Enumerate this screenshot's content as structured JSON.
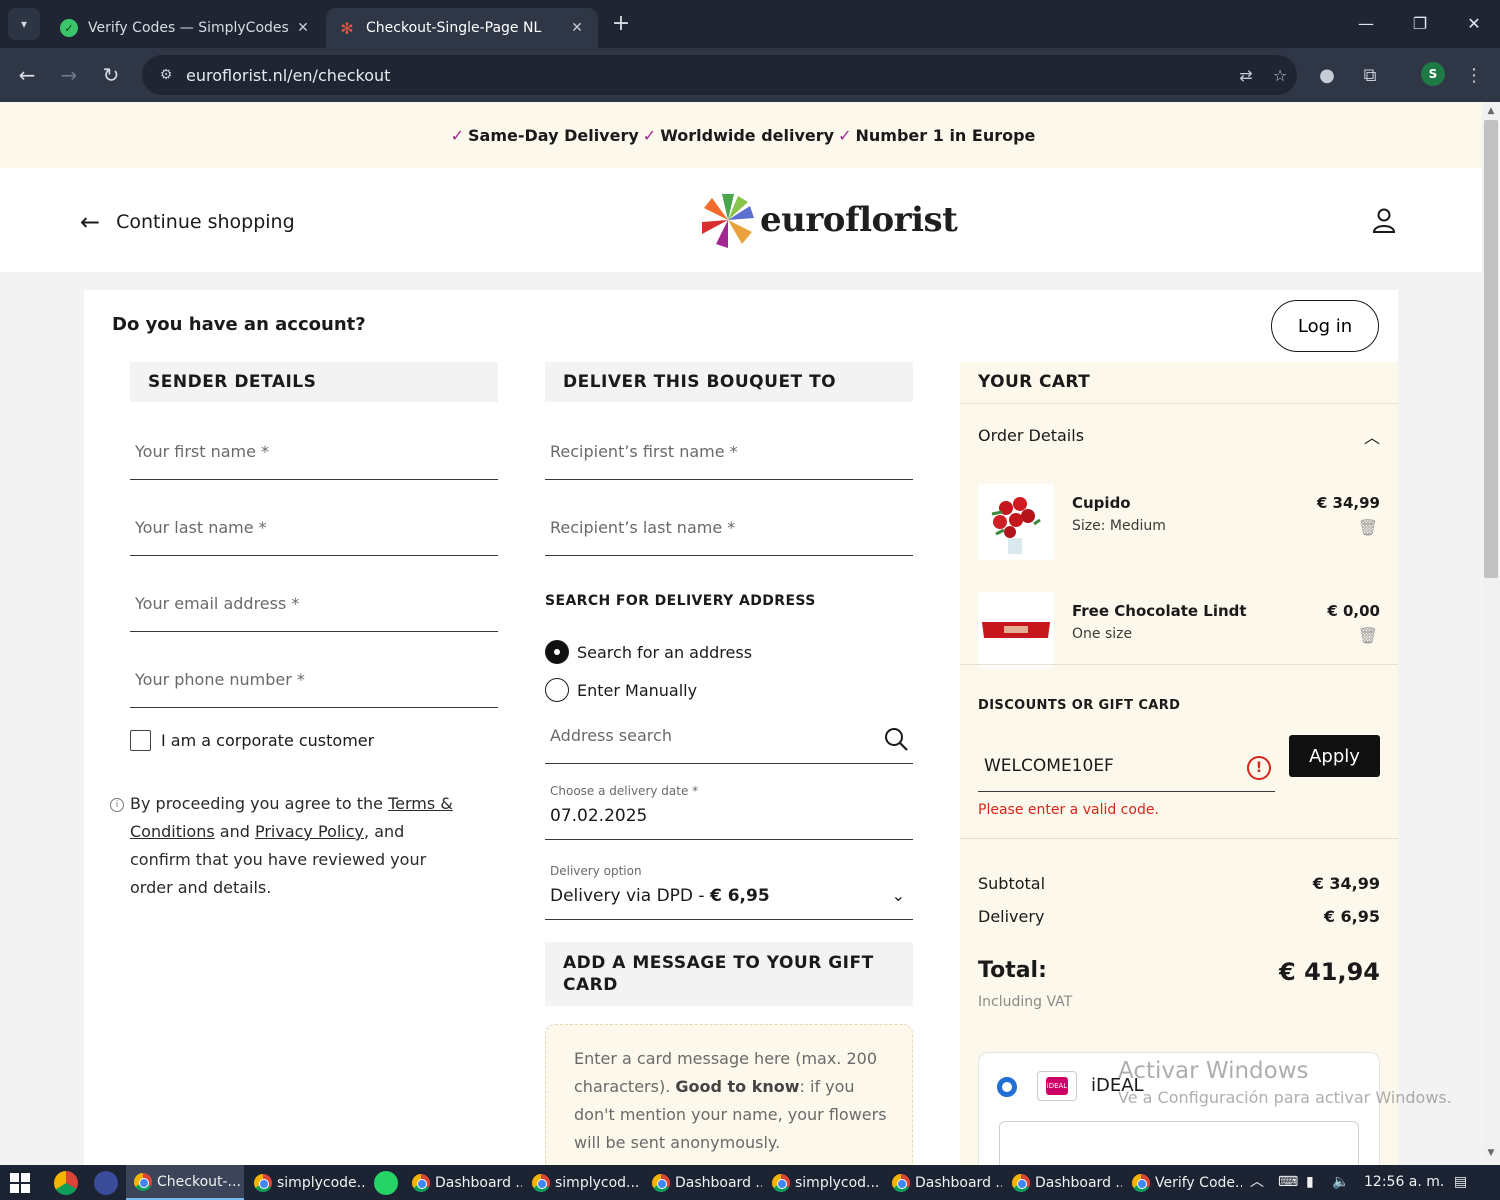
{
  "browser": {
    "tabs": [
      {
        "label": "Verify Codes — SimplyCodes",
        "active": false
      },
      {
        "label": "Checkout-Single-Page NL",
        "active": true
      }
    ],
    "url": "euroflorist.nl/en/checkout",
    "profile_initial": "S"
  },
  "promo": {
    "items": [
      "Same-Day Delivery",
      "Worldwide delivery",
      "Number 1 in Europe"
    ],
    "check_color": "#a2288f"
  },
  "header": {
    "back_label": "Continue shopping",
    "logo_text": "euroflorist"
  },
  "account": {
    "question": "Do you have an account?",
    "login_label": "Log in"
  },
  "sender": {
    "heading": "SENDER DETAILS",
    "first_name_ph": "Your first name *",
    "last_name_ph": "Your last name *",
    "email_ph": "Your email address *",
    "phone_ph": "Your phone number *",
    "corporate_label": "I am a corporate customer",
    "terms": {
      "prefix": "By proceeding you agree to the ",
      "terms_link": "Terms & Conditions",
      "and": " and ",
      "privacy_link": "Privacy Policy",
      "suffix": ", and confirm that you have reviewed your order and details."
    }
  },
  "recipient": {
    "heading": "DELIVER THIS BOUQUET TO",
    "first_name_ph": "Recipient’s first name *",
    "last_name_ph": "Recipient’s last name *",
    "search_heading": "SEARCH FOR DELIVERY ADDRESS",
    "radio_search": "Search for an address",
    "radio_manual": "Enter Manually",
    "address_ph": "Address search",
    "date_label": "Choose a delivery date *",
    "date_value": "07.02.2025",
    "delivery_option_label": "Delivery option",
    "delivery_option_value": "Delivery via DPD -",
    "delivery_option_price": "€ 6,95",
    "message_heading": "ADD A MESSAGE TO YOUR GIFT CARD",
    "message_ph_a": "Enter a card message here (max. 200 characters). ",
    "message_ph_bold": "Good to know",
    "message_ph_b": ": if you don't mention your name, your flowers will be sent anonymously."
  },
  "cart": {
    "heading": "YOUR CART",
    "order_details": "Order Details",
    "items": [
      {
        "name": "Cupido",
        "size": "Size: Medium",
        "price": "€ 34,99"
      },
      {
        "name": "Free Chocolate Lindt",
        "size": "One size",
        "price": "€ 0,00"
      }
    ],
    "discount_heading": "DISCOUNTS OR GIFT CARD",
    "discount_code": "WELCOME10EF",
    "apply_label": "Apply",
    "error": "Please enter a valid code.",
    "subtotal_label": "Subtotal",
    "subtotal": "€ 34,99",
    "delivery_label": "Delivery",
    "delivery": "€ 6,95",
    "total_label": "Total:",
    "total": "€ 41,94",
    "vat_note": "Including VAT",
    "payment_method": "iDEAL",
    "payment_logo_text": "iDEAL"
  },
  "watermark": {
    "line1": "Activar Windows",
    "line2": "Ve a Configuración para activar Windows."
  },
  "taskbar": {
    "items": [
      "Checkout-...",
      "simplycode...",
      "Dashboard ...",
      "simplycod...",
      "Dashboard ...",
      "simplycod...",
      "Dashboard ...",
      "Dashboard ...",
      "Verify Code..."
    ],
    "time": "12:56 a. m."
  }
}
